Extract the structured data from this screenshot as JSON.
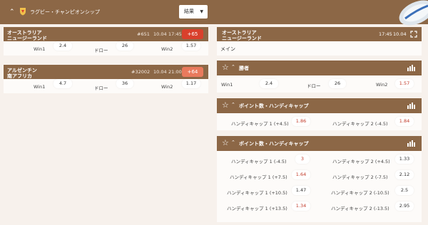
{
  "header": {
    "title": "ラグビー・チャンピオンシップ",
    "filter_value": "結果",
    "accent": "#8c6746"
  },
  "matches": [
    {
      "team1": "オーストラリア",
      "team2": "ニュージーランド",
      "id": "#651",
      "date": "10.04",
      "time": "17:45",
      "count": "+65",
      "count_color": "#d9402c",
      "odds": [
        {
          "label": "Win1",
          "value": "2.4"
        },
        {
          "label": "ドロー",
          "value": "26"
        },
        {
          "label": "Win2",
          "value": "1.57"
        }
      ]
    },
    {
      "team1": "アルゼンチン",
      "team2": "南アフリカ",
      "id": "#32002",
      "date": "10.04",
      "time": "21:00",
      "count": "+64",
      "count_color": "#e97a5d",
      "odds": [
        {
          "label": "Win1",
          "value": "4.7"
        },
        {
          "label": "ドロー",
          "value": "36"
        },
        {
          "label": "Win2",
          "value": "1.17"
        }
      ]
    }
  ],
  "detail": {
    "team1": "オーストラリア",
    "team2": "ニュージーランド",
    "time": "17:45",
    "date": "10.04",
    "tab": "メイン",
    "winner": {
      "title": "勝者",
      "odds": [
        {
          "label": "Win1",
          "value": "2.4"
        },
        {
          "label": "ドロー",
          "value": "26"
        },
        {
          "label": "Win2",
          "value": "1.57"
        }
      ]
    },
    "handicap_points": {
      "title": "ポイント数・ハンディキャップ",
      "odds": [
        {
          "label": "ハンディキャップ 1 (+4.5)",
          "value": "1.86"
        },
        {
          "label": "ハンディキャップ 2 (-4.5)",
          "value": "1.84"
        }
      ]
    },
    "handicap_points2": {
      "title": "ポイント数・ハンディキャップ",
      "rows": [
        [
          {
            "label": "ハンディキャップ 1 (-4.5)",
            "value": "3"
          },
          {
            "label": "ハンディキャップ 2 (+4.5)",
            "value": "1.33"
          }
        ],
        [
          {
            "label": "ハンディキャップ 1 (+7.5)",
            "value": "1.64"
          },
          {
            "label": "ハンディキャップ 2 (-7.5)",
            "value": "2.12"
          }
        ],
        [
          {
            "label": "ハンディキャップ 1 (+10.5)",
            "value": "1.47"
          },
          {
            "label": "ハンディキャップ 2 (-10.5)",
            "value": "2.5"
          }
        ],
        [
          {
            "label": "ハンディキャップ 1 (+13.5)",
            "value": "1.34"
          },
          {
            "label": "ハンディキャップ 2 (-13.5)",
            "value": "2.95"
          }
        ]
      ]
    }
  }
}
